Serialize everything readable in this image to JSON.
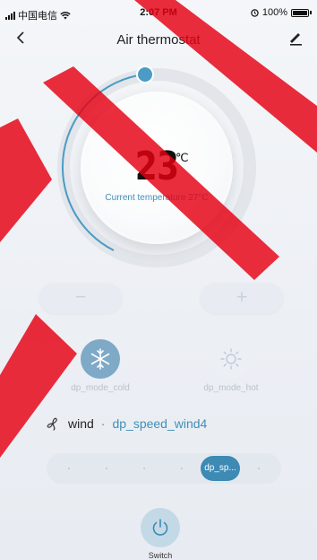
{
  "status_bar": {
    "carrier": "中国电信",
    "time": "2:07 PM",
    "battery": "100%"
  },
  "nav": {
    "title": "Air thermostat",
    "back_icon": "chevron-left-icon",
    "edit_icon": "pencil-icon"
  },
  "dial": {
    "set_temperature": "23",
    "unit": "℃",
    "current_temperature_text": "Current temperature 27°C",
    "accent_color": "#3f8fb8"
  },
  "controls": {
    "minus_label": "−",
    "plus_label": "+"
  },
  "modes": [
    {
      "label": "dp_mode_cold",
      "icon": "snowflake-icon",
      "active": true
    },
    {
      "label": "dp_mode_hot",
      "icon": "sun-icon",
      "active": false
    }
  ],
  "wind": {
    "label": "wind",
    "separator": "·",
    "value": "dp_speed_wind4",
    "icon": "fan-icon"
  },
  "speed_slider": {
    "selected_label": "dp_sp...",
    "selected_index": 4,
    "step_count": 6
  },
  "switch": {
    "label": "Switch",
    "icon": "power-icon"
  }
}
